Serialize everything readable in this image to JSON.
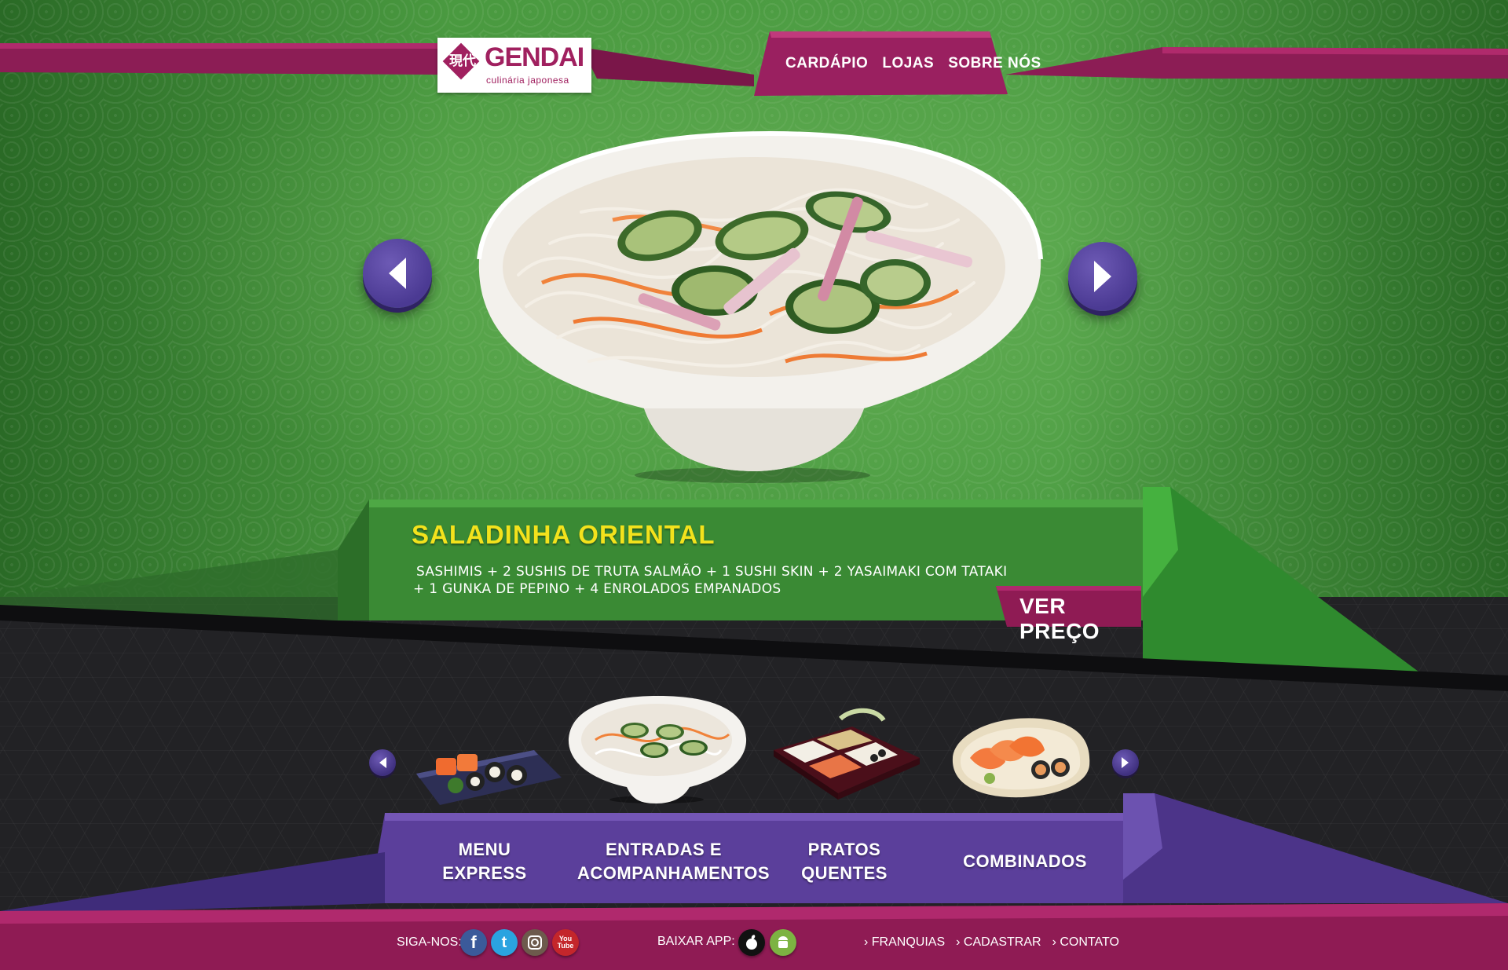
{
  "brand": {
    "name": "GENDAI",
    "tagline": "culinária japonesa",
    "kanji": "現代"
  },
  "nav": [
    {
      "label": "CARDÁPIO"
    },
    {
      "label": "LOJAS"
    },
    {
      "label": "SOBRE NÓS"
    }
  ],
  "featured": {
    "title": "SALADINHA ORIENTAL",
    "description_line1": "SASHIMIS + 2 SUSHIS DE TRUTA SALMÃO + 1 SUSHI SKIN + 2 YASAIMAKI COM TATAKI",
    "description_line2": "+ 1 GUNKA DE PEPINO + 4 ENROLADOS EMPANADOS",
    "price_button": "VER PREÇO"
  },
  "categories": [
    {
      "line1": "MENU",
      "line2": "EXPRESS"
    },
    {
      "line1": "ENTRADAS E",
      "line2": "ACOMPANHAMENTOS"
    },
    {
      "line1": "PRATOS",
      "line2": "QUENTES"
    },
    {
      "line1": "COMBINADOS",
      "line2": ""
    }
  ],
  "footer": {
    "follow_label": "SIGA-NOS:",
    "app_label": "BAIXAR APP:",
    "links": [
      {
        "label": "FRANQUIAS"
      },
      {
        "label": "CADASTRAR"
      },
      {
        "label": "CONTATO"
      }
    ],
    "social_glyphs": {
      "facebook": "f",
      "twitter": "t",
      "youtube_line1": "You",
      "youtube_line2": "Tube"
    }
  },
  "icons": {
    "prev": "chevron-left-icon",
    "next": "chevron-right-icon",
    "social": [
      "facebook-icon",
      "twitter-icon",
      "instagram-icon",
      "youtube-icon"
    ],
    "apps": [
      "apple-icon",
      "android-icon"
    ]
  },
  "colors": {
    "magenta": "#a0205f",
    "purple": "#5b3f9b",
    "green": "#3f8f3a",
    "title_yellow": "#f3e21c"
  }
}
